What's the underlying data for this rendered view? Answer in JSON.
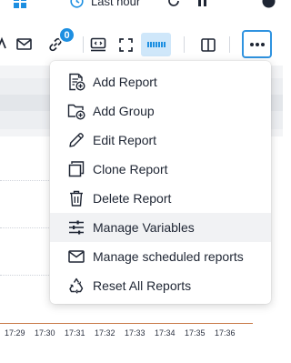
{
  "header": {
    "time_range_label": "Last hour"
  },
  "toolbar": {
    "notification_count": "0"
  },
  "chart": {
    "x_ticks": [
      "17:29",
      "17:30",
      "17:31",
      "17:32",
      "17:33",
      "17:34",
      "17:35",
      "17:36"
    ]
  },
  "menu": {
    "items": [
      {
        "label": "Add Report",
        "icon": "add-report-icon"
      },
      {
        "label": "Add Group",
        "icon": "add-group-icon"
      },
      {
        "label": "Edit Report",
        "icon": "pencil-icon"
      },
      {
        "label": "Clone Report",
        "icon": "clone-icon"
      },
      {
        "label": "Delete Report",
        "icon": "trash-icon"
      },
      {
        "label": "Manage Variables",
        "icon": "sliders-icon"
      },
      {
        "label": "Manage scheduled reports",
        "icon": "envelope-icon"
      },
      {
        "label": "Reset All Reports",
        "icon": "recycle-icon"
      }
    ]
  },
  "colors": {
    "accent": "#1d8fe1",
    "active_border": "#2f93e0",
    "toggle_bg": "#cfe7fa",
    "axis": "#c97b4a",
    "text": "#1e2533"
  }
}
